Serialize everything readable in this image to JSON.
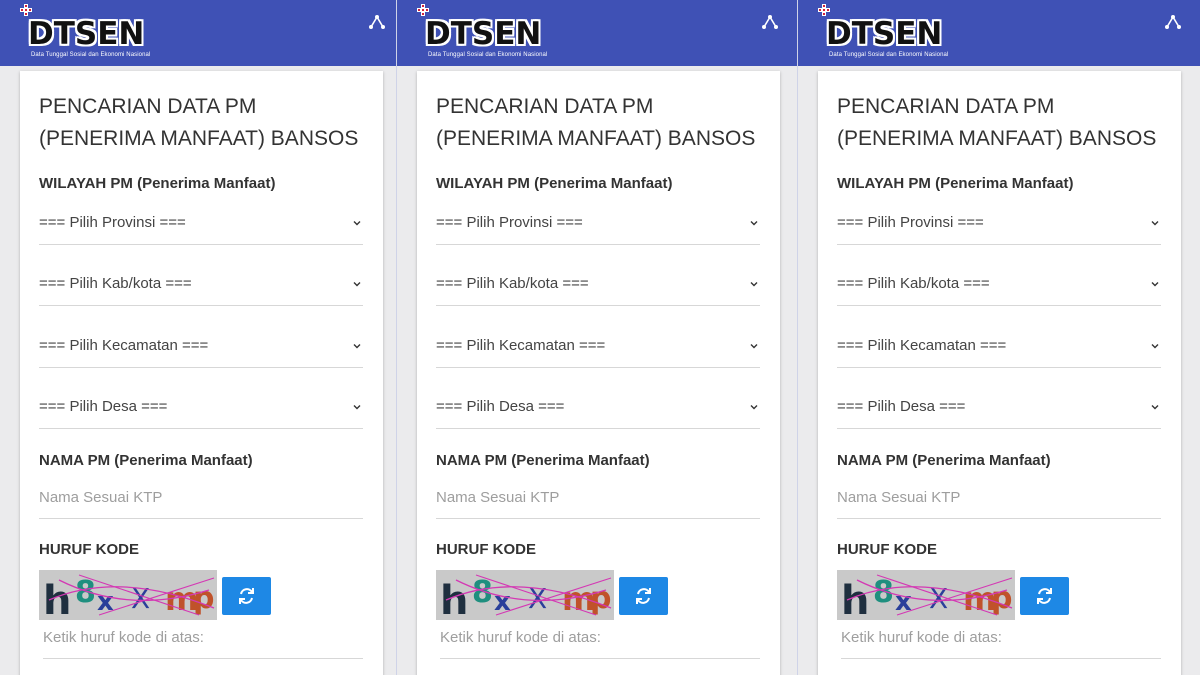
{
  "app": {
    "logo_text": "DTSEN",
    "logo_tagline": "Data Tunggal Sosial dan Ekonomi Nasional",
    "share_icon": "share-icon"
  },
  "form": {
    "title": "PENCARIAN DATA PM (PENERIMA MANFAAT) BANSOS",
    "wilayah_label": "WILAYAH PM (Penerima Manfaat)",
    "provinsi": "=== Pilih Provinsi ===",
    "kabkota": "=== Pilih Kab/kota ===",
    "kecamatan": "=== Pilih Kecamatan ===",
    "desa": "=== Pilih Desa ===",
    "nama_label": "NAMA PM (Penerima Manfaat)",
    "nama_placeholder": "Nama Sesuai KTP",
    "kode_label": "HURUF KODE",
    "captcha_text": "h8xXmp",
    "kode_placeholder": "Ketik huruf kode di atas:",
    "refresh_icon": "refresh-icon"
  },
  "colors": {
    "header": "#3f51b5",
    "button": "#1e88e5",
    "logo_accent": "#d3213a"
  }
}
